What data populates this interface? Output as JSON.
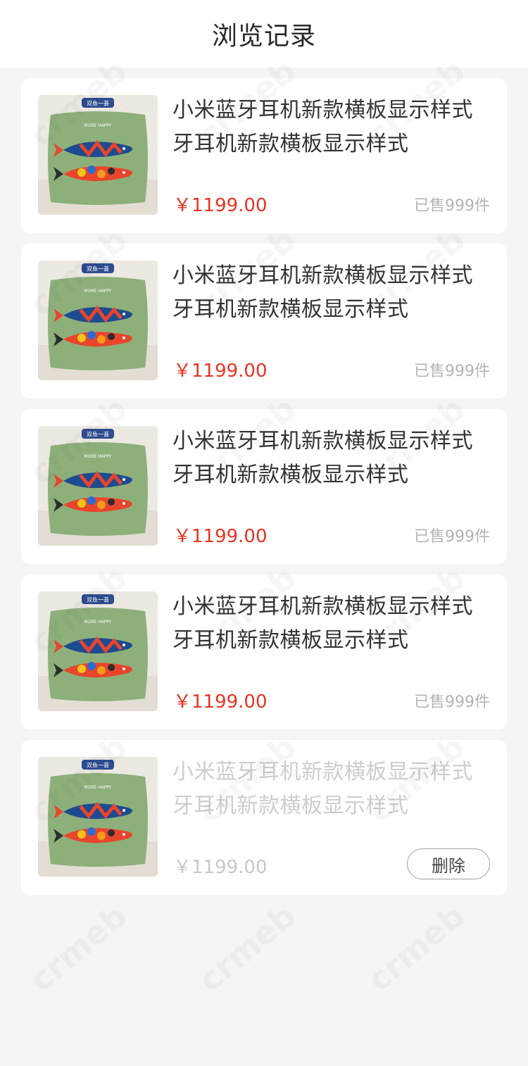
{
  "header": {
    "title": "浏览记录"
  },
  "product_badge": "双鱼一荟",
  "product_print": "MORE HAPPY",
  "watermark_text": "crmeb",
  "items": [
    {
      "name": "小米蓝牙耳机新款横板显示样式牙耳机新款横板显示样式",
      "price": "￥1199.00",
      "sold": "已售999件"
    },
    {
      "name": "小米蓝牙耳机新款横板显示样式牙耳机新款横板显示样式",
      "price": "￥1199.00",
      "sold": "已售999件"
    },
    {
      "name": "小米蓝牙耳机新款横板显示样式牙耳机新款横板显示样式",
      "price": "￥1199.00",
      "sold": "已售999件"
    },
    {
      "name": "小米蓝牙耳机新款横板显示样式牙耳机新款横板显示样式",
      "price": "￥1199.00",
      "sold": "已售999件"
    },
    {
      "name": "小米蓝牙耳机新款横板显示样式牙耳机新款横板显示样式",
      "price": "￥1199.00",
      "delete_label": "删除"
    }
  ],
  "colors": {
    "price_red": "#e93323",
    "background": "#f5f5f5",
    "pillow_green": "#8db07a"
  }
}
